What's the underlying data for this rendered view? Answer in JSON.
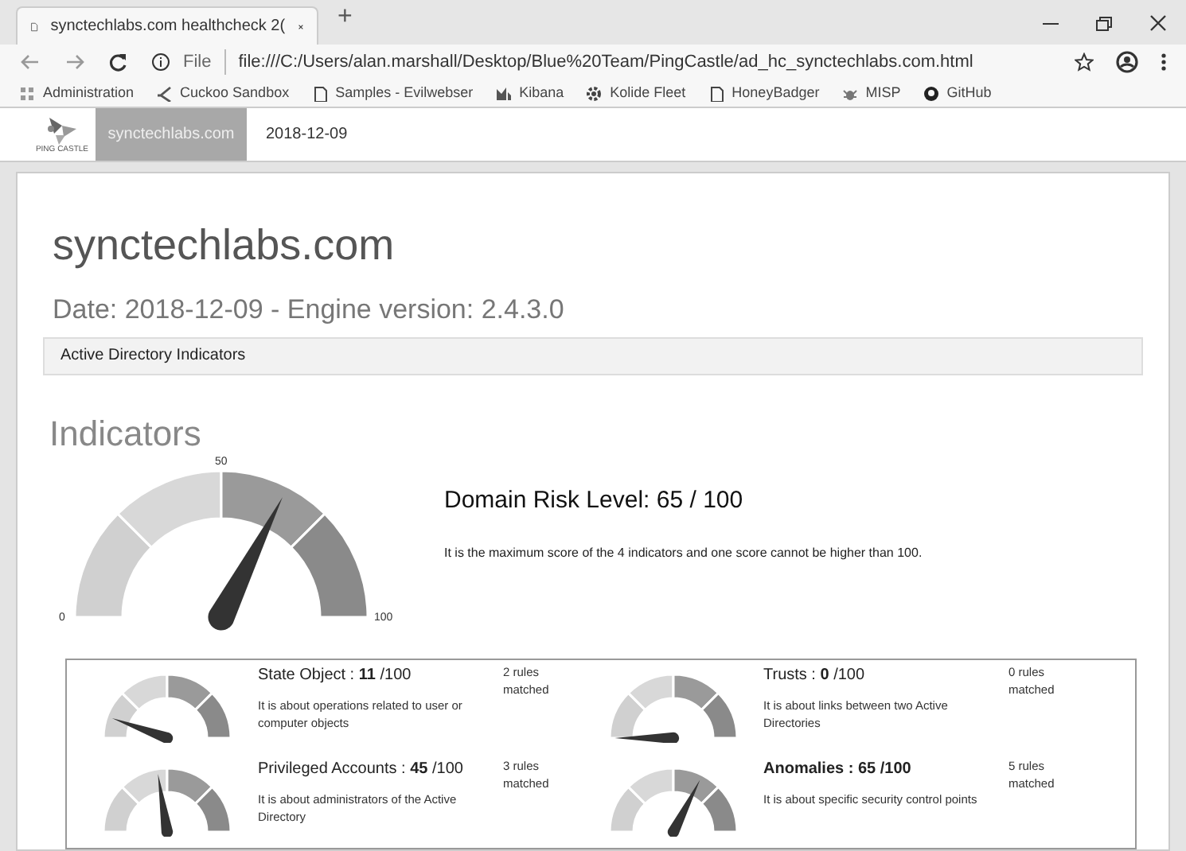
{
  "browser": {
    "tab_title": "synctechlabs.com healthcheck 2(",
    "new_tab": "+",
    "address_scheme": "File",
    "address": "file:///C:/Users/alan.marshall/Desktop/Blue%20Team/PingCastle/ad_hc_synctechlabs.com.html",
    "bookmarks": [
      {
        "label": "Administration",
        "kind": "apps"
      },
      {
        "label": "Cuckoo Sandbox",
        "kind": "tool"
      },
      {
        "label": "Samples - Evilwebser",
        "kind": "page"
      },
      {
        "label": "Kibana",
        "kind": "chart"
      },
      {
        "label": "Kolide Fleet",
        "kind": "gear"
      },
      {
        "label": "HoneyBadger",
        "kind": "page"
      },
      {
        "label": "MISP",
        "kind": "bug"
      },
      {
        "label": "GitHub",
        "kind": "github"
      }
    ]
  },
  "navbar": {
    "logo_text": "PING CASTLE",
    "items": [
      {
        "label": "synctechlabs.com",
        "selected": true
      },
      {
        "label": "2018-12-09",
        "selected": false
      }
    ]
  },
  "report": {
    "title": "synctechlabs.com",
    "subtitle": "Date: 2018-12-09 - Engine version: 2.4.3.0",
    "tab": "Active Directory Indicators"
  },
  "indicators": {
    "heading": "Indicators",
    "gauge": {
      "ticks": [
        "0",
        "50",
        "100"
      ]
    },
    "risk_title": "Domain Risk Level: 65 / 100",
    "risk_text": "It is the maximum score of the 4 indicators and one score cannot be higher than 100.",
    "items": [
      {
        "title": "State Object : **11** /100",
        "emphasized": false,
        "description": "It is about operations related to user or computer objects",
        "rules": "2 rules matched"
      },
      {
        "title": "Trusts : **0** /100",
        "emphasized": false,
        "description": "It is about links between two Active Directories",
        "rules": "0 rules matched"
      },
      {
        "title": "Privileged Accounts : **45** /100",
        "emphasized": false,
        "description": "It is about administrators of the Active Directory",
        "rules": "3 rules matched"
      },
      {
        "title": "Anomalies : 65 /100",
        "emphasized": true,
        "description": "It is about specific security control points",
        "rules": "5 rules matched"
      }
    ]
  }
}
